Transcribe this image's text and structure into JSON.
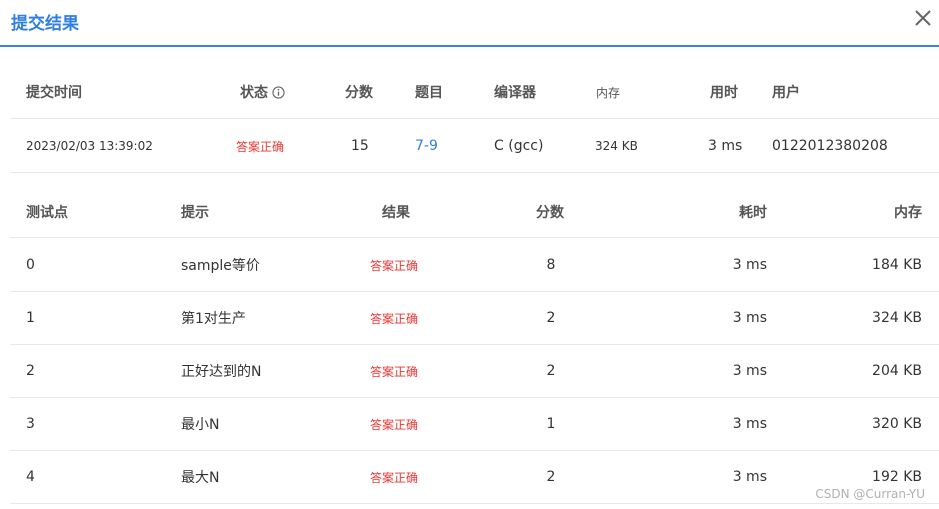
{
  "dialog": {
    "title": "提交结果",
    "close_icon": "close-icon"
  },
  "colors": {
    "accent": "#2f7fe0",
    "ok": "#e53935"
  },
  "summary": {
    "headers": {
      "submit_time": "提交时间",
      "status": "状态",
      "score": "分数",
      "problem": "题目",
      "compiler": "编译器",
      "memory": "内存",
      "time": "用时",
      "user": "用户"
    },
    "row": {
      "submit_time": "2023/02/03 13:39:02",
      "status": "答案正确",
      "score": "15",
      "problem": "7-9",
      "compiler": "C (gcc)",
      "memory": "324 KB",
      "time": "3 ms",
      "user": "0122012380208"
    }
  },
  "testcases": {
    "headers": {
      "point": "测试点",
      "hint": "提示",
      "result": "结果",
      "score": "分数",
      "time": "耗时",
      "memory": "内存"
    },
    "rows": [
      {
        "point": "0",
        "hint": "sample等价",
        "result": "答案正确",
        "score": "8",
        "time": "3 ms",
        "memory": "184 KB"
      },
      {
        "point": "1",
        "hint": "第1对生产",
        "result": "答案正确",
        "score": "2",
        "time": "3 ms",
        "memory": "324 KB"
      },
      {
        "point": "2",
        "hint": "正好达到的N",
        "result": "答案正确",
        "score": "2",
        "time": "3 ms",
        "memory": "204 KB"
      },
      {
        "point": "3",
        "hint": "最小N",
        "result": "答案正确",
        "score": "1",
        "time": "3 ms",
        "memory": "320 KB"
      },
      {
        "point": "4",
        "hint": "最大N",
        "result": "答案正确",
        "score": "2",
        "time": "3 ms",
        "memory": "192 KB"
      }
    ]
  },
  "watermark": "CSDN @Curran-YU"
}
